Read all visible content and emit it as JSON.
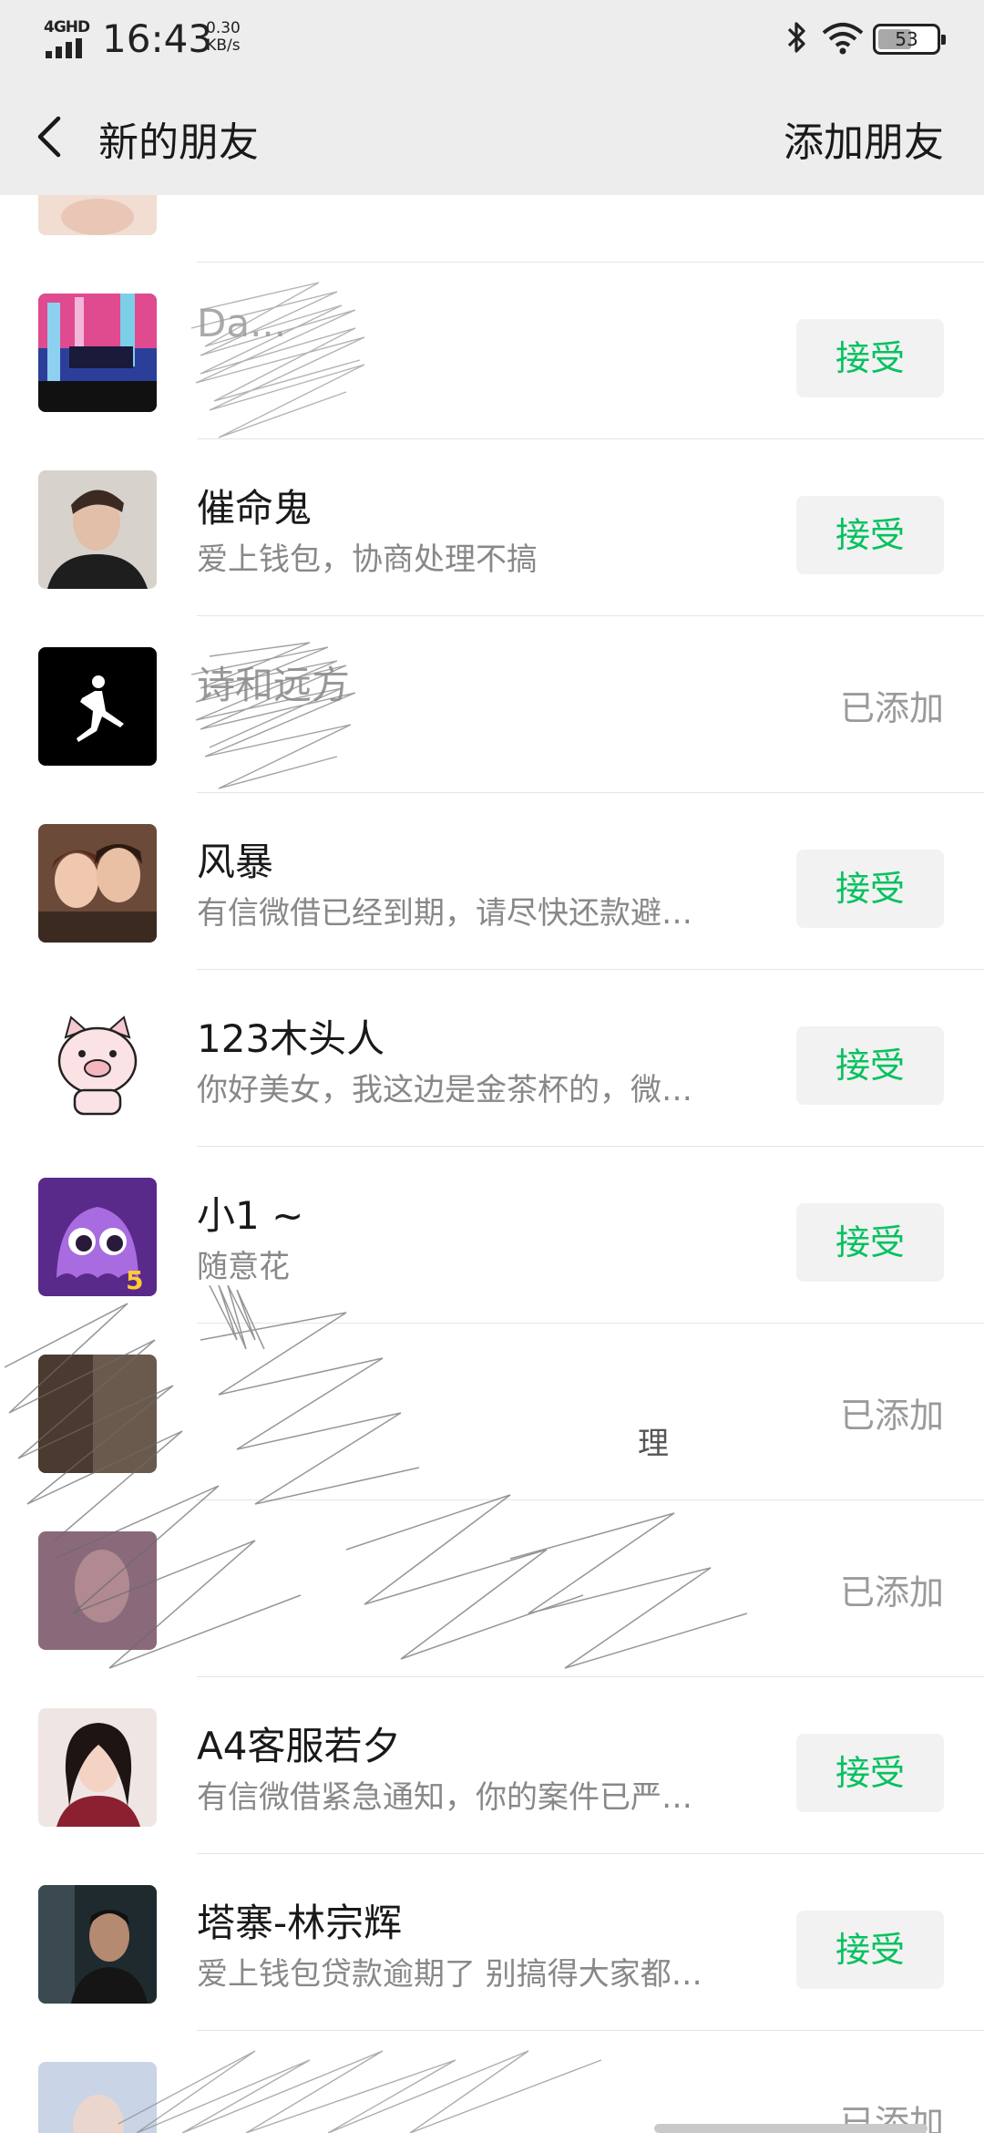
{
  "status_bar": {
    "network": "4GHD",
    "time": "16:43",
    "speed_value": "0.30",
    "speed_unit": "KB/s",
    "battery": "53",
    "icons": [
      "signal-icon",
      "bluetooth-icon",
      "wifi-icon",
      "battery-icon"
    ]
  },
  "header": {
    "back_icon": "chevron-left-icon",
    "title": "新的朋友",
    "add_friend": "添加朋友"
  },
  "accent_color": "#07c160",
  "rows": [
    {
      "name": "",
      "message": "",
      "status": "partial"
    },
    {
      "name": "Da...",
      "message": "",
      "status": "accept",
      "status_label": "接受",
      "obscured": true
    },
    {
      "name": "催命鬼",
      "message": "爱上钱包，协商处理不搞",
      "status": "accept",
      "status_label": "接受"
    },
    {
      "name": "诗和远方",
      "message": "",
      "status": "added",
      "status_label": "已添加",
      "obscured": true
    },
    {
      "name": "风暴",
      "message": "有信微借已经到期，请尽快还款避…",
      "status": "accept",
      "status_label": "接受"
    },
    {
      "name": "123木头人",
      "message": "你好美女，我这边是金茶杯的，微…",
      "status": "accept",
      "status_label": "接受"
    },
    {
      "name": "小1 ~",
      "message": "随意花",
      "status": "accept",
      "status_label": "接受"
    },
    {
      "name": "",
      "message": "理",
      "status": "added",
      "status_label": "已添加",
      "obscured": true
    },
    {
      "name": "",
      "message": "",
      "status": "added",
      "status_label": "已添加",
      "obscured": true
    },
    {
      "name": "A4客服若夕",
      "message": "有信微借紧急通知，你的案件已严…",
      "status": "accept",
      "status_label": "接受"
    },
    {
      "name": "塔寨-林宗辉",
      "message": "爱上钱包贷款逾期了 别搞得大家都…",
      "status": "accept",
      "status_label": "接受"
    },
    {
      "name": "",
      "message": "",
      "status": "added",
      "status_label": "已添加",
      "obscured": true
    }
  ]
}
